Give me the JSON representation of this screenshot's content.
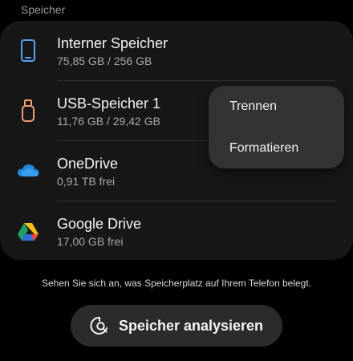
{
  "section": {
    "header": "Speicher"
  },
  "storage": {
    "items": [
      {
        "title": "Interner Speicher",
        "subtitle": "75,85 GB / 256 GB",
        "icon": "phone-icon"
      },
      {
        "title": "USB-Speicher 1",
        "subtitle": "11,76 GB / 29,42 GB",
        "icon": "usb-drive-icon"
      },
      {
        "title": "OneDrive",
        "subtitle": "0,91 TB frei",
        "icon": "onedrive-icon"
      },
      {
        "title": "Google Drive",
        "subtitle": "17,00 GB frei",
        "icon": "google-drive-icon"
      }
    ]
  },
  "context_menu": {
    "items": [
      {
        "label": "Trennen"
      },
      {
        "label": "Formatieren"
      }
    ]
  },
  "footer": {
    "hint": "Sehen Sie sich an, was Speicherplatz auf Ihrem Telefon belegt.",
    "analyze_label": "Speicher analysieren",
    "analyze_icon": "storage-analyze-icon"
  },
  "colors": {
    "background": "#010101",
    "card": "#171717",
    "menu": "#333333",
    "button": "#2b2b2b",
    "phone_icon": "#5aa0f0",
    "usb_icon": "#f0a070",
    "onedrive_blue": "#1e86d8",
    "gdrive_green": "#1ea362",
    "gdrive_yellow": "#f8be1c",
    "gdrive_blue": "#2f6fd8"
  }
}
